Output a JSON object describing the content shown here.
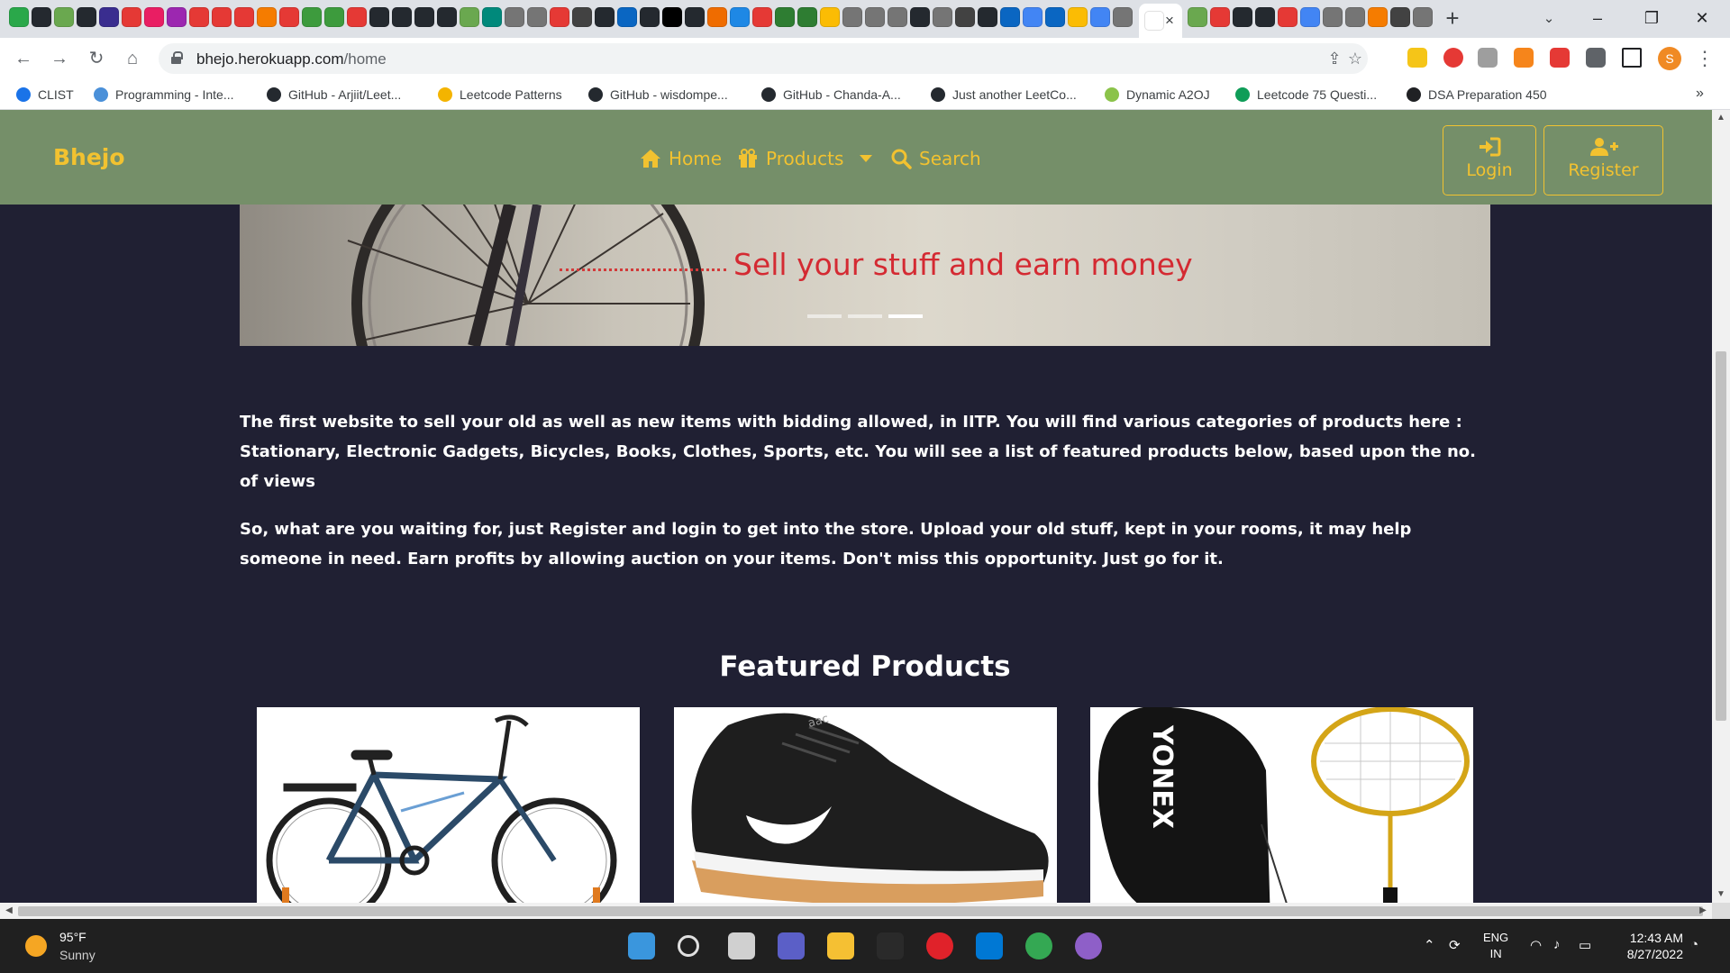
{
  "browser": {
    "tab_close": "×",
    "new_tab": "+",
    "tab_search": "⌄",
    "window_controls": [
      "–",
      "❐",
      "✕"
    ],
    "url_domain": "bhejo.herokuapp.com",
    "url_path": "/home",
    "profile_initial": "S",
    "favicon_colors": [
      "#2aa84a",
      "#24292f",
      "#6aa84f",
      "#24292f",
      "#3a2d8f",
      "#e53935",
      "#e91e63",
      "#9c27b0",
      "#e53935",
      "#e53935",
      "#e53935",
      "#f57c00",
      "#e53935",
      "#3d9b3d",
      "#3d9b3d",
      "#e53935",
      "#24292f",
      "#24292f",
      "#24292f",
      "#24292f",
      "#6aa84f",
      "#00897b",
      "#757575",
      "#757575",
      "#e53935",
      "#424242",
      "#24292f",
      "#0a66c2",
      "#24292f",
      "#000000",
      "#24292f",
      "#ef6c00",
      "#1e88e5",
      "#e53935",
      "#2e7d32",
      "#2e7d32",
      "#fbbc04",
      "#757575",
      "#757575",
      "#757575",
      "#24292f",
      "#757575",
      "#424242",
      "#24292f",
      "#0a66c2",
      "#4285f4",
      "#0a66c2",
      "#fbbc04",
      "#4285f4",
      "#757575"
    ],
    "favicon_colors_after": [
      "#6aa84f",
      "#e53935",
      "#24292f",
      "#24292f",
      "#e53935",
      "#4285f4",
      "#757575",
      "#757575",
      "#f57c00",
      "#424242",
      "#757575"
    ]
  },
  "bookmarks": [
    {
      "label": "CLIST",
      "color": "#1a73e8"
    },
    {
      "label": "Programming - Inte...",
      "color": "#4a90d9"
    },
    {
      "label": "GitHub - Arjiit/Leet...",
      "color": "#24292f"
    },
    {
      "label": "Leetcode Patterns",
      "color": "#f4b400"
    },
    {
      "label": "GitHub - wisdompe...",
      "color": "#24292f"
    },
    {
      "label": "GitHub - Chanda-A...",
      "color": "#24292f"
    },
    {
      "label": "Just another LeetCo...",
      "color": "#24292f"
    },
    {
      "label": "Dynamic A2OJ",
      "color": "#8bc34a"
    },
    {
      "label": "Leetcode 75 Questi...",
      "color": "#0f9d58"
    },
    {
      "label": "DSA Preparation 450",
      "color": "#202124"
    }
  ],
  "bookmarks_more": "»",
  "site": {
    "brand": "Bhejo",
    "nav": {
      "home": "Home",
      "products": "Products",
      "search": "Search"
    },
    "auth": {
      "login": "Login",
      "register": "Register"
    },
    "hero_text": "Sell your stuff and earn money",
    "hero_slides": [
      false,
      false,
      true
    ],
    "intro": [
      "The first website to sell your old as well as new items with bidding allowed, in IITP. You will find various categories of products here : Stationary, Electronic Gadgets, Bicycles, Books, Clothes, Sports, etc. You will see a list of featured products below, based upon the no. of views",
      "So, what are you waiting for, just Register and login to get into the store. Upload your old stuff, kept in your rooms, it may help someone in need. Earn profits by allowing auction on your items. Don't miss this opportunity. Just go for it."
    ],
    "featured_title": "Featured Products",
    "products": [
      {
        "name": "bicycle"
      },
      {
        "name": "sports-shoe"
      },
      {
        "name": "badminton-racket",
        "brand_text": "YONEX"
      }
    ]
  },
  "taskbar": {
    "weather_temp": "95°F",
    "weather_condition": "Sunny",
    "language": "ENG",
    "region": "IN",
    "time": "12:43 AM",
    "date": "8/27/2022"
  }
}
